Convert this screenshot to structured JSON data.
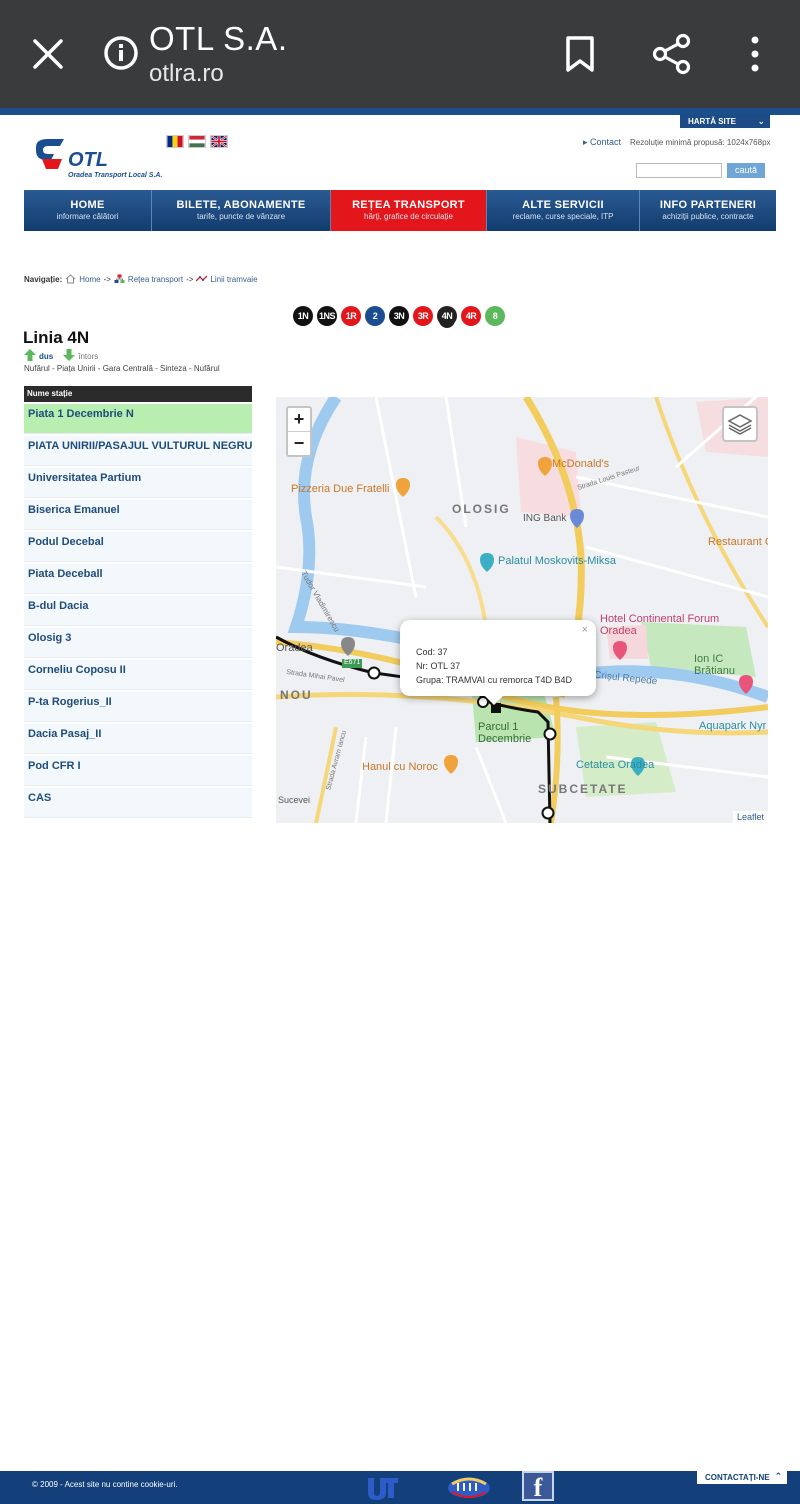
{
  "browser": {
    "title": "OTL S.A.",
    "url": "otlra.ro"
  },
  "header": {
    "sitemap_label": "HARTĂ SITE",
    "logo_text": "OTL",
    "logo_subtitle": "Oradea Transport Local S.A.",
    "contact_label": "Contact",
    "resolution_text": "Rezoluție minimă propusă: 1024x768px",
    "search_value": "",
    "search_button": "caută"
  },
  "menu": [
    {
      "title": "HOME",
      "subtitle": "informare călători"
    },
    {
      "title": "BILETE, ABONAMENTE",
      "subtitle": "tarife, puncte de vânzare"
    },
    {
      "title": "REȚEA TRANSPORT",
      "subtitle": "hărți, grafice de circulație"
    },
    {
      "title": "ALTE SERVICII",
      "subtitle": "reclame, curse speciale, ITP"
    },
    {
      "title": "INFO PARTENERI",
      "subtitle": "achiziții publice, contracte"
    }
  ],
  "breadcrumb": {
    "label": "Navigație:",
    "items": [
      "Home",
      "Rețea transport",
      "Linii tramvaie"
    ],
    "separator": "->"
  },
  "lines": [
    {
      "label": "1N",
      "color": "#111111"
    },
    {
      "label": "1NS",
      "color": "#111111"
    },
    {
      "label": "1R",
      "color": "#e3161b"
    },
    {
      "label": "2",
      "color": "#1b4e91"
    },
    {
      "label": "3N",
      "color": "#111111"
    },
    {
      "label": "3R",
      "color": "#e3161b"
    },
    {
      "label": "4N",
      "color": "#222222"
    },
    {
      "label": "4R",
      "color": "#e3161b"
    },
    {
      "label": "8",
      "color": "#5cb85c"
    }
  ],
  "line": {
    "title": "Linia 4N",
    "dir_dus": "dus",
    "dir_intors": "întors",
    "route": "Nufărul - Piața Unirii - Gara Centrală - Sinteza - Nufărul"
  },
  "stations": {
    "header": "Nume stație",
    "items": [
      "Piata 1 Decembrie N",
      "PIATA UNIRII/PASAJUL VULTURUL NEGRU",
      "Universitatea Partium",
      "Biserica Emanuel",
      "Podul Decebal",
      "Piata Deceball",
      "B-dul Dacia",
      "Olosig 3",
      "Corneliu Coposu II",
      "P-ta Rogerius_II",
      "Dacia Pasaj_II",
      "Pod CFR I",
      "CAS"
    ]
  },
  "map": {
    "zoom_in": "+",
    "zoom_out": "−",
    "labels": {
      "mcdonalds": "McDonald's",
      "pizzeria": "Pizzeria Due Fratelli",
      "olosig": "OLOSIG",
      "ing": "ING Bank",
      "palatul": "Palatul Moskovits-Miksa",
      "restaurant": "Restaurant C",
      "hotel": "Hotel Continental Forum Oradea",
      "ion": "Ion IC Brătianu",
      "aquapark": "Aquapark Nyr",
      "cetatea": "Cetatea Oradea",
      "subcetate": "SUBCETATE",
      "hanul": "Hanul cu Noroc",
      "parcul": "Parcul 1 Decembrie",
      "oradea": "Oradea",
      "nou": "NOU",
      "crisul": "Crișul Repede",
      "louis": "Strada Louis Pasteur",
      "tudor": "Tudor Vladimirescu",
      "mihai_pavel": "Strada Mihai Pavel",
      "avram": "Strada Avram Iancu",
      "sucevei": "Sucevei",
      "e671": "E671"
    },
    "popup": {
      "close": "×",
      "cod": "Cod: 37",
      "nr": "Nr: OTL 37",
      "grupa": "Grupa: TRAMVAI cu remorca T4D B4D"
    },
    "attribution": "Leaflet"
  },
  "footer": {
    "copyright": "© 2009 - Acest site nu contine cookie-uri.",
    "contact_label": "CONTACTAȚI-NE",
    "fb_letter": "f"
  }
}
